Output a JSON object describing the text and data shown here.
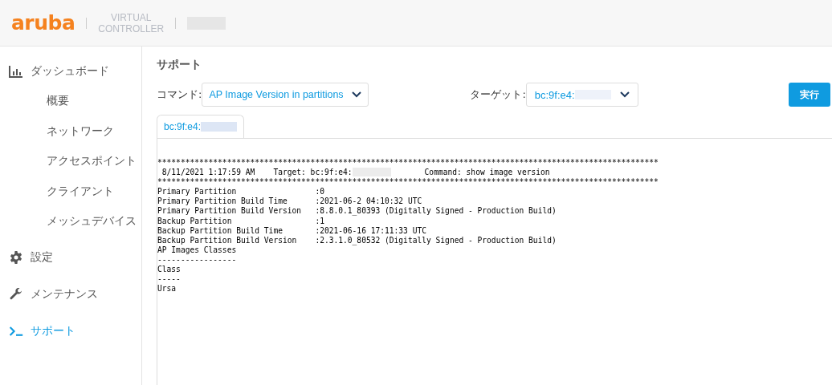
{
  "header": {
    "logo": "aruba",
    "product": [
      "VIRTUAL",
      "CONTROLLER"
    ]
  },
  "sidebar": {
    "items": [
      {
        "kind": "top",
        "label": "ダッシュボード",
        "selected": false,
        "children": [
          {
            "label": "概要",
            "selected": false
          },
          {
            "label": "ネットワーク",
            "selected": false
          },
          {
            "label": "アクセスポイント",
            "selected": false
          },
          {
            "label": "クライアント",
            "selected": false
          },
          {
            "label": "メッシュデバイス",
            "selected": false
          }
        ]
      },
      {
        "kind": "top",
        "label": "設定",
        "selected": false
      },
      {
        "kind": "top",
        "label": "メンテナンス",
        "selected": false
      },
      {
        "kind": "top",
        "label": "サポート",
        "selected": true
      }
    ]
  },
  "page": {
    "title": "サポート",
    "command": {
      "label": "コマンド:",
      "value": "AP Image Version in partitions"
    },
    "target": {
      "label": "ターゲット:",
      "value": "bc:9f:e4:"
    },
    "run_button": "実行",
    "tabs": [
      {
        "label": "bc:9f:e4:",
        "selected": true
      }
    ],
    "output": [
      {
        "text": "************************************************************************************************************"
      },
      {
        "text": " 8/11/2021 1:17:59 AM    Target: bc:9f:e4:",
        "after": "Command: show image version"
      },
      {
        "text": "************************************************************************************************************"
      },
      {
        "text": "Primary Partition                 :0"
      },
      {
        "text": "Primary Partition Build Time      :2021-06-2 04:10:32 UTC"
      },
      {
        "text": "Primary Partition Build Version   :8.8.0.1_80393 (Digitally Signed - Production Build)"
      },
      {
        "text": "Backup Partition                  :1"
      },
      {
        "text": "Backup Partition Build Time       :2021-06-16 17:11:33 UTC"
      },
      {
        "text": "Backup Partition Build Version    :2.3.1.0_80532 (Digitally Signed - Production Build)"
      },
      {
        "text": "AP Images Classes"
      },
      {
        "text": "-----------------"
      },
      {
        "text": "Class"
      },
      {
        "text": "-----"
      },
      {
        "text": "Ursa"
      }
    ]
  }
}
